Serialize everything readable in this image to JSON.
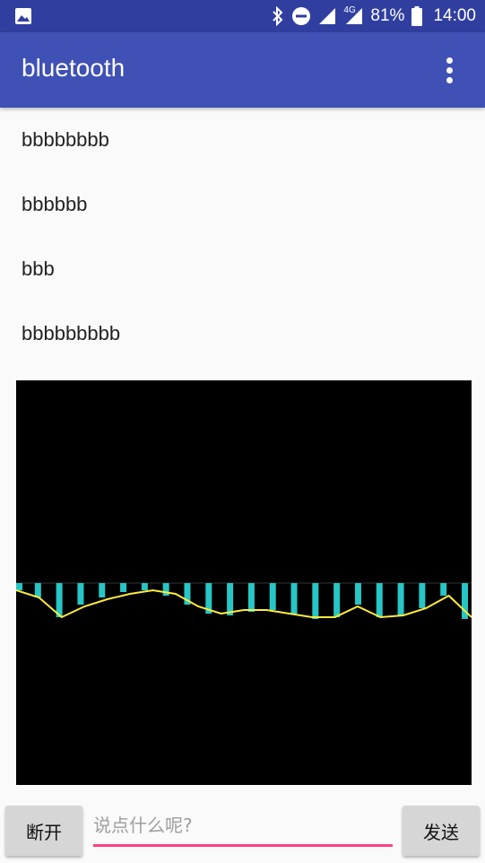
{
  "status_bar": {
    "battery": "81%",
    "time": "14:00",
    "network": "4G"
  },
  "app_bar": {
    "title": "bluetooth"
  },
  "messages": [
    "bbbbbbbb",
    "bbbbbb",
    "bbb",
    "bbbbbbbbb"
  ],
  "chart_data": {
    "type": "bar",
    "bar_color": "#26c6c6",
    "line_color": "#ffeb3b",
    "background": "#000000",
    "bars": [
      8,
      16,
      38,
      24,
      16,
      10,
      8,
      14,
      24,
      34,
      36,
      32,
      30,
      34,
      40,
      38,
      24,
      38,
      36,
      28,
      14,
      40
    ],
    "line": [
      8,
      16,
      38,
      26,
      18,
      12,
      8,
      12,
      26,
      34,
      30,
      30,
      34,
      38,
      38,
      26,
      38,
      36,
      28,
      14,
      38
    ]
  },
  "controls": {
    "disconnect_label": "断开",
    "input_placeholder": "说点什么呢?",
    "input_value": "",
    "send_label": "发送"
  },
  "colors": {
    "status_bar": "#303f9f",
    "app_bar": "#3f51b5",
    "accent": "#ff4081"
  }
}
